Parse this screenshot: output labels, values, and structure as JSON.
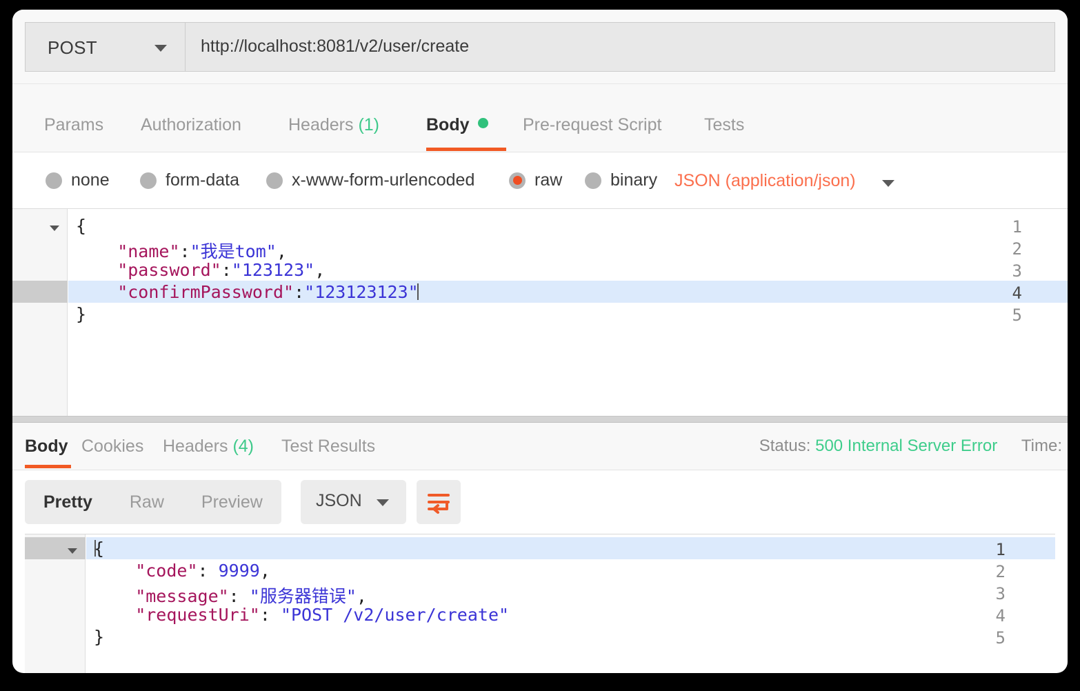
{
  "app": "Postman",
  "request": {
    "method": "POST",
    "method_caret_icon": "chevron-down-icon",
    "url": "http://localhost:8081/v2/user/create",
    "tabs": [
      {
        "label": "Params",
        "active": false
      },
      {
        "label": "Authorization",
        "active": false
      },
      {
        "label": "Headers",
        "count": "(1)",
        "active": false
      },
      {
        "label": "Body",
        "active": true,
        "dot": true
      },
      {
        "label": "Pre-request Script",
        "active": false
      },
      {
        "label": "Tests",
        "active": false
      }
    ],
    "body_types": [
      {
        "label": "none",
        "selected": false
      },
      {
        "label": "form-data",
        "selected": false
      },
      {
        "label": "x-www-form-urlencoded",
        "selected": false
      },
      {
        "label": "raw",
        "selected": true
      },
      {
        "label": "binary",
        "selected": false
      }
    ],
    "content_type": "JSON (application/json)",
    "content_type_caret_icon": "chevron-down-icon",
    "editor": {
      "active_line": 4,
      "lines": [
        {
          "num": "1",
          "fold": true,
          "tokens": [
            {
              "t": "{",
              "c": "p"
            }
          ]
        },
        {
          "num": "2",
          "fold": false,
          "tokens": [
            {
              "t": "    \"name\"",
              "c": "k"
            },
            {
              "t": ":",
              "c": "p"
            },
            {
              "t": "\"我是tom\"",
              "c": "v"
            },
            {
              "t": ",",
              "c": "p"
            }
          ]
        },
        {
          "num": "3",
          "fold": false,
          "tokens": [
            {
              "t": "    \"password\"",
              "c": "k"
            },
            {
              "t": ":",
              "c": "p"
            },
            {
              "t": "\"123123\"",
              "c": "v"
            },
            {
              "t": ",",
              "c": "p"
            }
          ]
        },
        {
          "num": "4",
          "fold": false,
          "tokens": [
            {
              "t": "    \"confirmPassword\"",
              "c": "k"
            },
            {
              "t": ":",
              "c": "p"
            },
            {
              "t": "\"123123123\"",
              "c": "v"
            }
          ]
        },
        {
          "num": "5",
          "fold": false,
          "tokens": [
            {
              "t": "}",
              "c": "p"
            }
          ]
        }
      ]
    }
  },
  "response": {
    "tabs": [
      {
        "label": "Body",
        "active": true
      },
      {
        "label": "Cookies",
        "active": false
      },
      {
        "label": "Headers",
        "count": "(4)",
        "active": false
      },
      {
        "label": "Test Results",
        "active": false
      }
    ],
    "status_label": "Status:",
    "status_value": "500 Internal Server Error",
    "time_label": "Time:",
    "view_modes": [
      {
        "label": "Pretty",
        "active": true
      },
      {
        "label": "Raw",
        "active": false
      },
      {
        "label": "Preview",
        "active": false
      }
    ],
    "format": "JSON",
    "format_caret_icon": "chevron-down-icon",
    "wrap_icon": "word-wrap-icon",
    "editor": {
      "active_line": 1,
      "lines": [
        {
          "num": "1",
          "fold": true,
          "tokens": [
            {
              "t": "{",
              "c": "p"
            }
          ]
        },
        {
          "num": "2",
          "fold": false,
          "tokens": [
            {
              "t": "    \"code\"",
              "c": "k"
            },
            {
              "t": ": ",
              "c": "p"
            },
            {
              "t": "9999",
              "c": "v"
            },
            {
              "t": ",",
              "c": "p"
            }
          ]
        },
        {
          "num": "3",
          "fold": false,
          "tokens": [
            {
              "t": "    \"message\"",
              "c": "k"
            },
            {
              "t": ": ",
              "c": "p"
            },
            {
              "t": "\"服务器错误\"",
              "c": "v"
            },
            {
              "t": ",",
              "c": "p"
            }
          ]
        },
        {
          "num": "4",
          "fold": false,
          "tokens": [
            {
              "t": "    \"requestUri\"",
              "c": "k"
            },
            {
              "t": ": ",
              "c": "p"
            },
            {
              "t": "\"POST /v2/user/create\"",
              "c": "v"
            }
          ]
        },
        {
          "num": "5",
          "fold": false,
          "tokens": [
            {
              "t": "}",
              "c": "p"
            }
          ]
        }
      ]
    }
  },
  "colors": {
    "accent": "#f15a24",
    "content_type": "#fb6f4d",
    "status_ok": "#3ecd8b",
    "count_green": "#3ec98a",
    "key": "#a5155c",
    "value": "#3b34d6",
    "active_line_bg": "#dceafc"
  }
}
